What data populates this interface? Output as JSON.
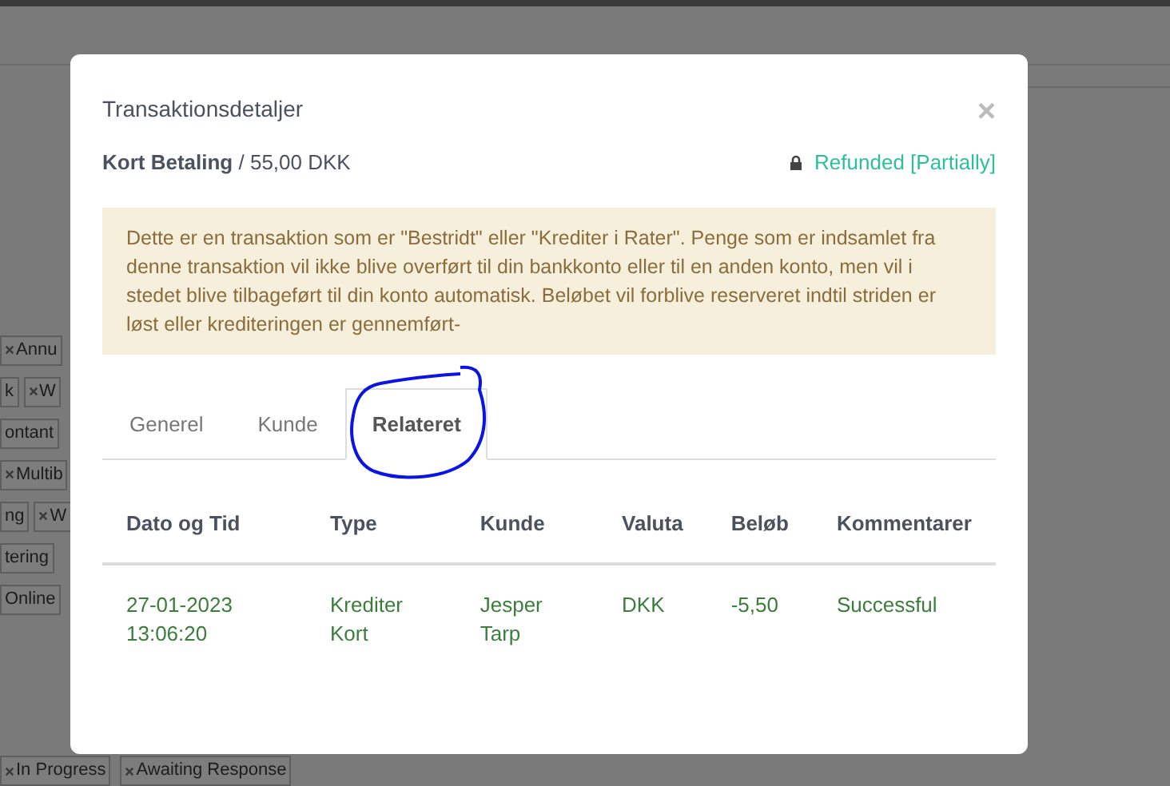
{
  "background_tags": [
    [
      {
        "label": "Annu",
        "removable": true
      }
    ],
    [
      {
        "label": "k",
        "removable": false
      },
      {
        "label": "W",
        "removable": true
      }
    ],
    [
      {
        "label": "ontant",
        "removable": false
      }
    ],
    [
      {
        "label": "Multib",
        "removable": true
      }
    ],
    [
      {
        "label": "ng",
        "removable": false
      },
      {
        "label": "W",
        "removable": true
      }
    ],
    [
      {
        "label": "tering",
        "removable": false
      }
    ],
    [
      {
        "label": "Online",
        "removable": false
      }
    ]
  ],
  "bottom_tags": [
    {
      "label": "In Progress",
      "removable": true
    },
    {
      "label": "Awaiting Response",
      "removable": true
    }
  ],
  "modal": {
    "title": "Transaktionsdetaljer",
    "close": "×",
    "payment_type": "Kort Betaling",
    "amount": "/ 55,00 DKK",
    "status": "Refunded [Partially]",
    "locked": true,
    "alert": "Dette er en transaktion som er \"Bestridt\" eller \"Krediter i Rater\". Penge som er indsamlet fra denne transaktion vil ikke blive overført til din bankkonto eller til en anden konto, men vil i stedet blive tilbageført til din konto automatisk. Beløbet vil forblive reserveret indtil striden er løst eller krediteringen er gennemført-",
    "tabs": [
      {
        "label": "Generel",
        "selected": false
      },
      {
        "label": "Kunde",
        "selected": false
      },
      {
        "label": "Relateret",
        "selected": true
      }
    ],
    "table": {
      "columns": [
        "Dato og Tid",
        "Type",
        "Kunde",
        "Valuta",
        "Beløb",
        "Kommentarer"
      ],
      "rows": [
        [
          "27-01-2023 13:06:20",
          "Krediter Kort",
          "Jesper Tarp",
          "DKK",
          "-5,50",
          "Successful"
        ]
      ]
    }
  }
}
